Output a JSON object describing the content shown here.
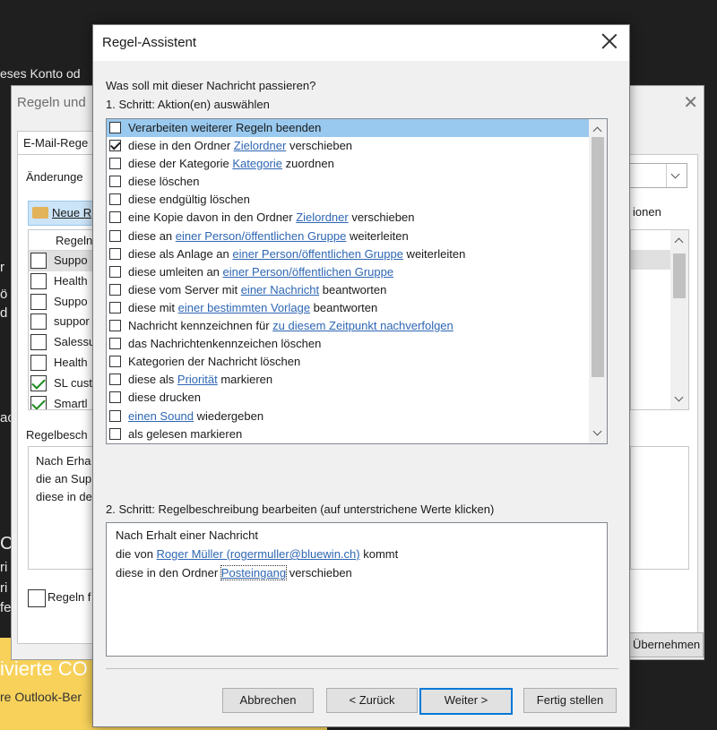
{
  "background": {
    "top_text": "eses Konto od",
    "left_fragments": [
      "r",
      "ö",
      "d",
      "ac",
      "C",
      "ri",
      "ri",
      "fe"
    ],
    "banner": {
      "big": "ivierte CO",
      "small": "re Outlook-Ber"
    }
  },
  "rules_window": {
    "title": "Regeln und",
    "tab": "E-Mail-Rege",
    "changes_label": "Änderunge",
    "new_rule": "Neue R",
    "list_header": "Regeln",
    "rules": [
      {
        "name": "Suppo",
        "checked": false,
        "selected": true
      },
      {
        "name": "Health",
        "checked": false,
        "selected": false
      },
      {
        "name": "Suppo",
        "checked": false,
        "selected": false
      },
      {
        "name": "suppor",
        "checked": false,
        "selected": false
      },
      {
        "name": "Salessu",
        "checked": false,
        "selected": false
      },
      {
        "name": "Health",
        "checked": false,
        "selected": false
      },
      {
        "name": "SL cust",
        "checked": true,
        "selected": false
      },
      {
        "name": "Smartl",
        "checked": true,
        "selected": false
      }
    ],
    "desc_label": "Regelbesch",
    "desc_lines": [
      "Nach Erha",
      "die an Sup",
      "diese in de"
    ],
    "enable_label": "Regeln f",
    "options_fragment": "ionen",
    "apply_fragment": "Übernehmen"
  },
  "dialog": {
    "title": "Regel-Assistent",
    "question": "Was soll mit dieser Nachricht passieren?",
    "step1": "1. Schritt: Aktion(en) auswählen",
    "actions": [
      {
        "checked": false,
        "selected": true,
        "pre": "Verarbeiten weiterer Regeln beenden",
        "link": "",
        "post": ""
      },
      {
        "checked": true,
        "selected": false,
        "pre": "diese in den Ordner ",
        "link": "Zielordner",
        "post": " verschieben"
      },
      {
        "checked": false,
        "selected": false,
        "pre": "diese der Kategorie ",
        "link": "Kategorie",
        "post": " zuordnen"
      },
      {
        "checked": false,
        "selected": false,
        "pre": "diese löschen",
        "link": "",
        "post": ""
      },
      {
        "checked": false,
        "selected": false,
        "pre": "diese endgültig löschen",
        "link": "",
        "post": ""
      },
      {
        "checked": false,
        "selected": false,
        "pre": "eine Kopie davon in den Ordner ",
        "link": "Zielordner",
        "post": " verschieben"
      },
      {
        "checked": false,
        "selected": false,
        "pre": "diese an ",
        "link": "einer Person/öffentlichen Gruppe",
        "post": " weiterleiten"
      },
      {
        "checked": false,
        "selected": false,
        "pre": "diese als Anlage an ",
        "link": "einer Person/öffentlichen Gruppe",
        "post": " weiterleiten"
      },
      {
        "checked": false,
        "selected": false,
        "pre": "diese umleiten an ",
        "link": "einer Person/öffentlichen Gruppe",
        "post": ""
      },
      {
        "checked": false,
        "selected": false,
        "pre": "diese vom Server mit ",
        "link": "einer Nachricht",
        "post": " beantworten"
      },
      {
        "checked": false,
        "selected": false,
        "pre": "diese mit ",
        "link": "einer bestimmten Vorlage",
        "post": " beantworten"
      },
      {
        "checked": false,
        "selected": false,
        "pre": "Nachricht kennzeichnen für ",
        "link": "zu diesem Zeitpunkt nachverfolgen",
        "post": ""
      },
      {
        "checked": false,
        "selected": false,
        "pre": "das Nachrichtenkennzeichen löschen",
        "link": "",
        "post": ""
      },
      {
        "checked": false,
        "selected": false,
        "pre": "Kategorien der Nachricht löschen",
        "link": "",
        "post": ""
      },
      {
        "checked": false,
        "selected": false,
        "pre": "diese als ",
        "link": "Priorität",
        "post": " markieren"
      },
      {
        "checked": false,
        "selected": false,
        "pre": "diese drucken",
        "link": "",
        "post": ""
      },
      {
        "checked": false,
        "selected": false,
        "pre": "",
        "link": "einen Sound",
        "post": " wiedergeben"
      },
      {
        "checked": false,
        "selected": false,
        "pre": "als gelesen markieren",
        "link": "",
        "post": ""
      }
    ],
    "step2": "2. Schritt: Regelbeschreibung bearbeiten (auf unterstrichene Werte klicken)",
    "description": {
      "line1": "Nach Erhalt einer Nachricht",
      "line2_pre": "die von ",
      "line2_link": "Roger Müller (rogermuller@bluewin.ch)",
      "line2_post": " kommt",
      "line3_pre": "diese in den Ordner ",
      "line3_link": "Posteingang",
      "line3_post": " verschieben"
    },
    "buttons": {
      "cancel": "Abbrechen",
      "back": "< Zurück",
      "next": "Weiter >",
      "finish": "Fertig stellen"
    }
  },
  "colors": {
    "link": "#2e66b3",
    "selection": "#99c9ef",
    "default_button_border": "#0078d7"
  }
}
